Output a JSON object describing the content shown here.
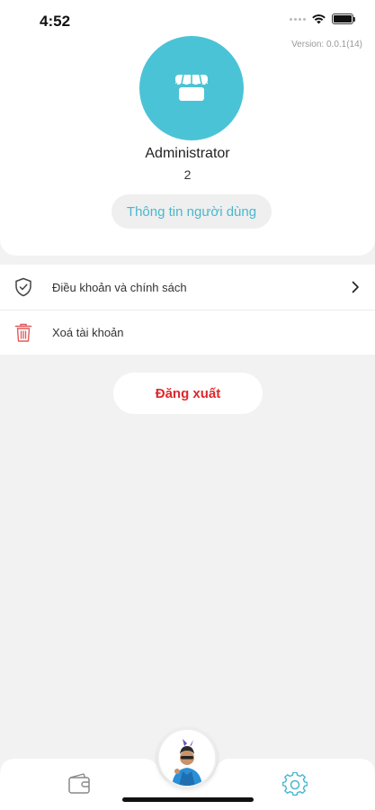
{
  "status_bar": {
    "time": "4:52"
  },
  "profile": {
    "version": "Version: 0.0.1(14)",
    "name": "Administrator",
    "id": "2",
    "info_button_label": "Thông tin người dùng",
    "avatar_icon": "store-icon",
    "avatar_color": "#4bc3d6"
  },
  "menu": {
    "items": [
      {
        "label": "Điều khoản và chính sách",
        "icon": "shield-check-icon",
        "chevron": true
      },
      {
        "label": "Xoá tài khoản",
        "icon": "trash-icon",
        "chevron": false
      }
    ]
  },
  "logout": {
    "label": "Đăng xuất",
    "color": "#e0262b"
  },
  "tab_bar": {
    "tabs": [
      {
        "name": "wallet",
        "icon": "wallet-icon",
        "active": false
      },
      {
        "name": "profile",
        "icon": "user-photo-avatar",
        "active": false
      },
      {
        "name": "settings",
        "icon": "gear-icon",
        "active": true
      }
    ],
    "accent": "#48b8cd"
  }
}
